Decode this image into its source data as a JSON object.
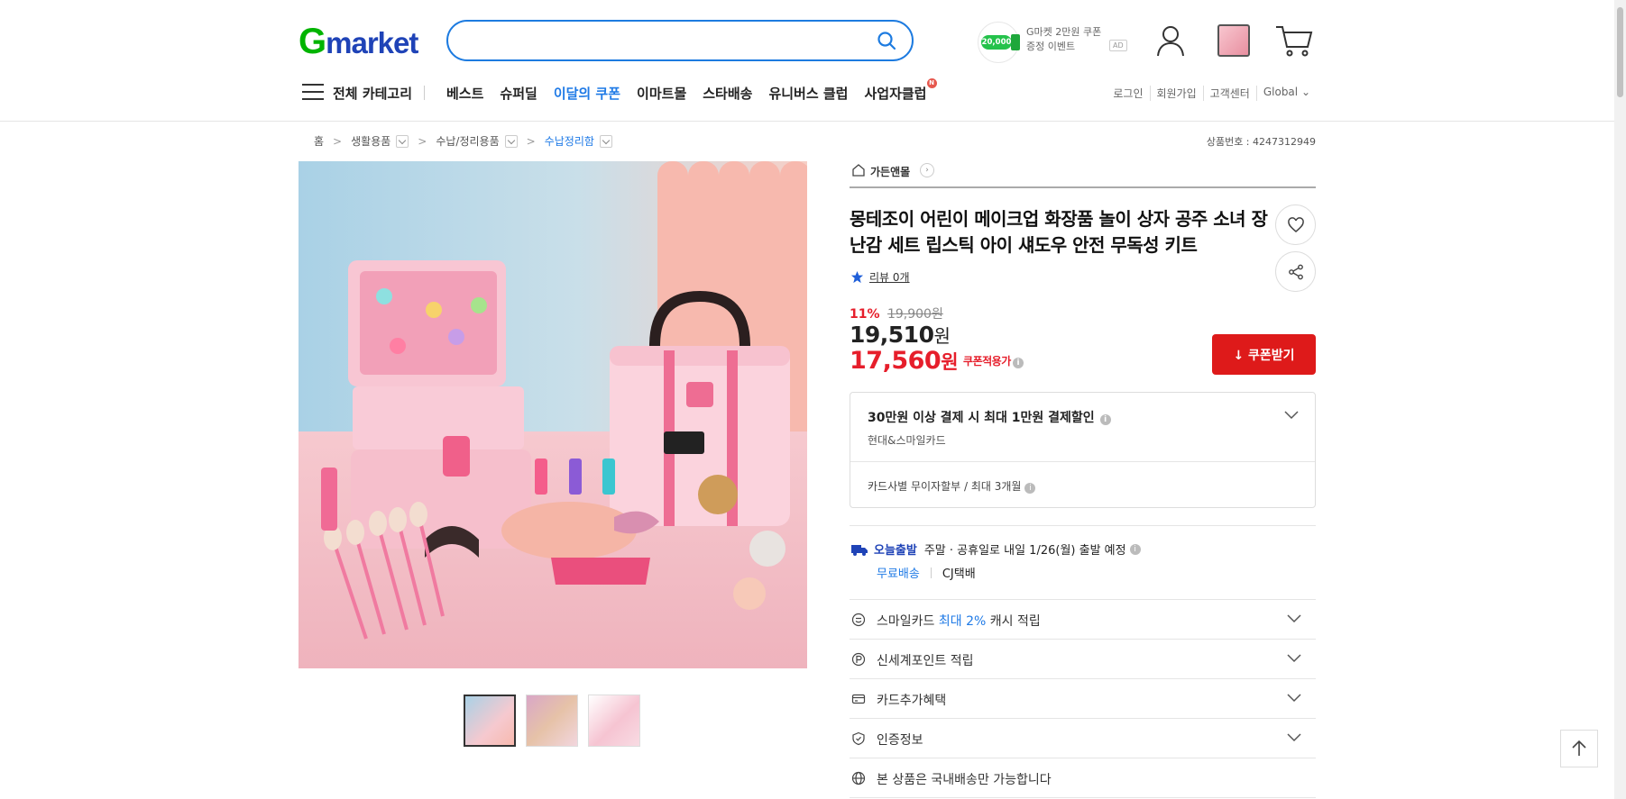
{
  "header": {
    "logo_g": "G",
    "logo_rest": "market",
    "search_placeholder": "",
    "promo": {
      "coin_amount": "20,000",
      "text": "G마켓 2만원 쿠폰 증정 이벤트",
      "ad": "AD"
    },
    "icons": [
      "user-icon",
      "recent-items-icon",
      "cart-icon"
    ]
  },
  "nav": {
    "all_categories": "전체 카테고리",
    "links": [
      {
        "label": "베스트"
      },
      {
        "label": "슈퍼딜"
      },
      {
        "label": "이달의 쿠폰",
        "highlight": true
      },
      {
        "label": "이마트몰"
      },
      {
        "label": "스타배송"
      },
      {
        "label": "유니버스 클럽"
      },
      {
        "label": "사업자클럽",
        "badge": "N"
      }
    ],
    "utility": [
      "로그인",
      "회원가입",
      "고객센터",
      "Global ⌄"
    ]
  },
  "breadcrumb": {
    "home": "홈",
    "items": [
      "생활용품",
      "수납/정리용품",
      "수납정리함"
    ],
    "arrow": ">"
  },
  "product_no": "상품번호 : 4247312949",
  "gallery": {
    "thumbnails": 3,
    "selected_index": 0
  },
  "product": {
    "store_name": "가든앤몰",
    "title": "몽테조이 어린이 메이크업 화장품 놀이 상자 공주 소녀 장난감 세트 립스틱 아이 섀도우 안전 무독성 키트",
    "review_text": "리뷰 0개",
    "discount_pct": "11%",
    "original_price": "19,900원",
    "price_num": "19,510",
    "price_unit": "원",
    "coupon_price_num": "17,560",
    "coupon_price_unit": "원",
    "coupon_price_label": "쿠폰적용가",
    "coupon_button": "↓ 쿠폰받기"
  },
  "card_benefit": {
    "title": "30만원 이상 결제 시 최대 1만원 결제할인",
    "cards": "현대&스마일카드",
    "installment": "카드사별 무이자할부 / 최대 3개월"
  },
  "shipping": {
    "today_label": "오늘출발",
    "schedule": "주말 · 공휴일로 내일 1/26(월) 출발 예정",
    "free": "무료배송",
    "carrier": "CJ택배"
  },
  "benefit_rows": [
    {
      "icon": "smile-icon",
      "label_pre": "스마일카드 ",
      "label_hi": "최대 2%",
      "label_post": " 캐시 적립"
    },
    {
      "icon": "point-icon",
      "label_pre": "신세계포인트 적립",
      "label_hi": "",
      "label_post": ""
    },
    {
      "icon": "card-icon",
      "label_pre": "카드추가혜택",
      "label_hi": "",
      "label_post": ""
    },
    {
      "icon": "shield-icon",
      "label_pre": "인증정보",
      "label_hi": "",
      "label_post": ""
    },
    {
      "icon": "globe-icon",
      "label_pre": "본 상품은 국내배송만 가능합니다",
      "label_hi": "",
      "label_post": ""
    }
  ],
  "colors": {
    "accent_blue": "#1f7ae6",
    "brand_green": "#00b400",
    "brand_navy": "#1f43b7",
    "sale_red": "#e61e2b",
    "coupon_button": "#de1a1a"
  }
}
